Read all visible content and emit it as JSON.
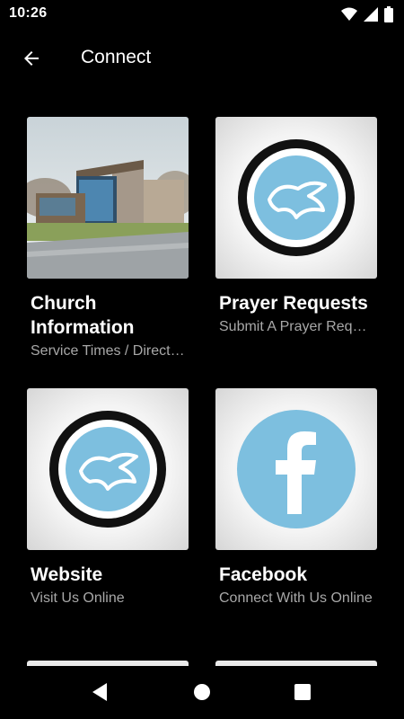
{
  "status_bar": {
    "time": "10:26",
    "icons": [
      "wifi-icon",
      "signal-icon",
      "battery-icon"
    ]
  },
  "app_bar": {
    "title": "Connect",
    "back_icon": "arrow-left-icon"
  },
  "cards": [
    {
      "title": "Church Information",
      "subtitle": "Service Times / Directions",
      "image": "church-building-photo"
    },
    {
      "title": "Prayer Requests",
      "subtitle": "Submit A Prayer Request",
      "image": "church-logo-icon"
    },
    {
      "title": "Website",
      "subtitle": "Visit Us Online",
      "image": "church-logo-icon"
    },
    {
      "title": "Facebook",
      "subtitle": "Connect With Us Online",
      "image": "facebook-icon"
    }
  ],
  "colors": {
    "background": "#000000",
    "logo_blue": "#7dbfdf",
    "subtitle_gray": "#a8a8a8"
  },
  "nav_bar": {
    "icons": [
      "back-triangle-icon",
      "home-circle-icon",
      "recents-square-icon"
    ]
  }
}
